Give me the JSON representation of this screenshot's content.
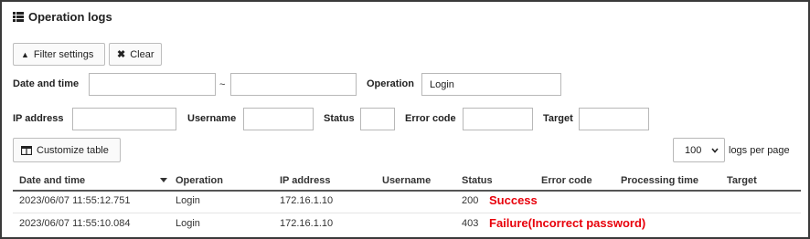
{
  "title": "Operation logs",
  "buttons": {
    "filter_settings": "Filter settings",
    "clear": "Clear",
    "customize_table": "Customize table"
  },
  "filters": {
    "date_time_label": "Date and time",
    "date_from_value": "",
    "date_separator": "~",
    "date_to_value": "",
    "operation_label": "Operation",
    "operation_value": "Login",
    "ip_label": "IP address",
    "ip_value": "",
    "username_label": "Username",
    "username_value": "",
    "status_label": "Status",
    "status_value": "",
    "error_code_label": "Error code",
    "error_code_value": "",
    "target_label": "Target",
    "target_value": ""
  },
  "pagination": {
    "per_page_value": "100",
    "per_page_label": "logs per page"
  },
  "table": {
    "columns": [
      "Date and time",
      "Operation",
      "IP address",
      "Username",
      "Status",
      "Error code",
      "Processing time",
      "Target"
    ],
    "rows": [
      {
        "date": "2023/06/07 11:55:12.751",
        "operation": "Login",
        "ip": "172.16.1.10",
        "username": "",
        "status_code": "200",
        "status_text": "Success",
        "error_code": "",
        "processing_time": "",
        "target": ""
      },
      {
        "date": "2023/06/07 11:55:10.084",
        "operation": "Login",
        "ip": "172.16.1.10",
        "username": "",
        "status_code": "403",
        "status_text": "Failure(Incorrect password)",
        "error_code": "",
        "processing_time": "",
        "target": ""
      }
    ]
  },
  "colors": {
    "status_highlight": "#e8000b"
  },
  "icons": {
    "title": "list-icon",
    "filter": "caret-up-icon",
    "clear": "close-icon",
    "customize": "table-icon",
    "sort": "sort-desc-icon",
    "select": "chevron-down-icon"
  }
}
